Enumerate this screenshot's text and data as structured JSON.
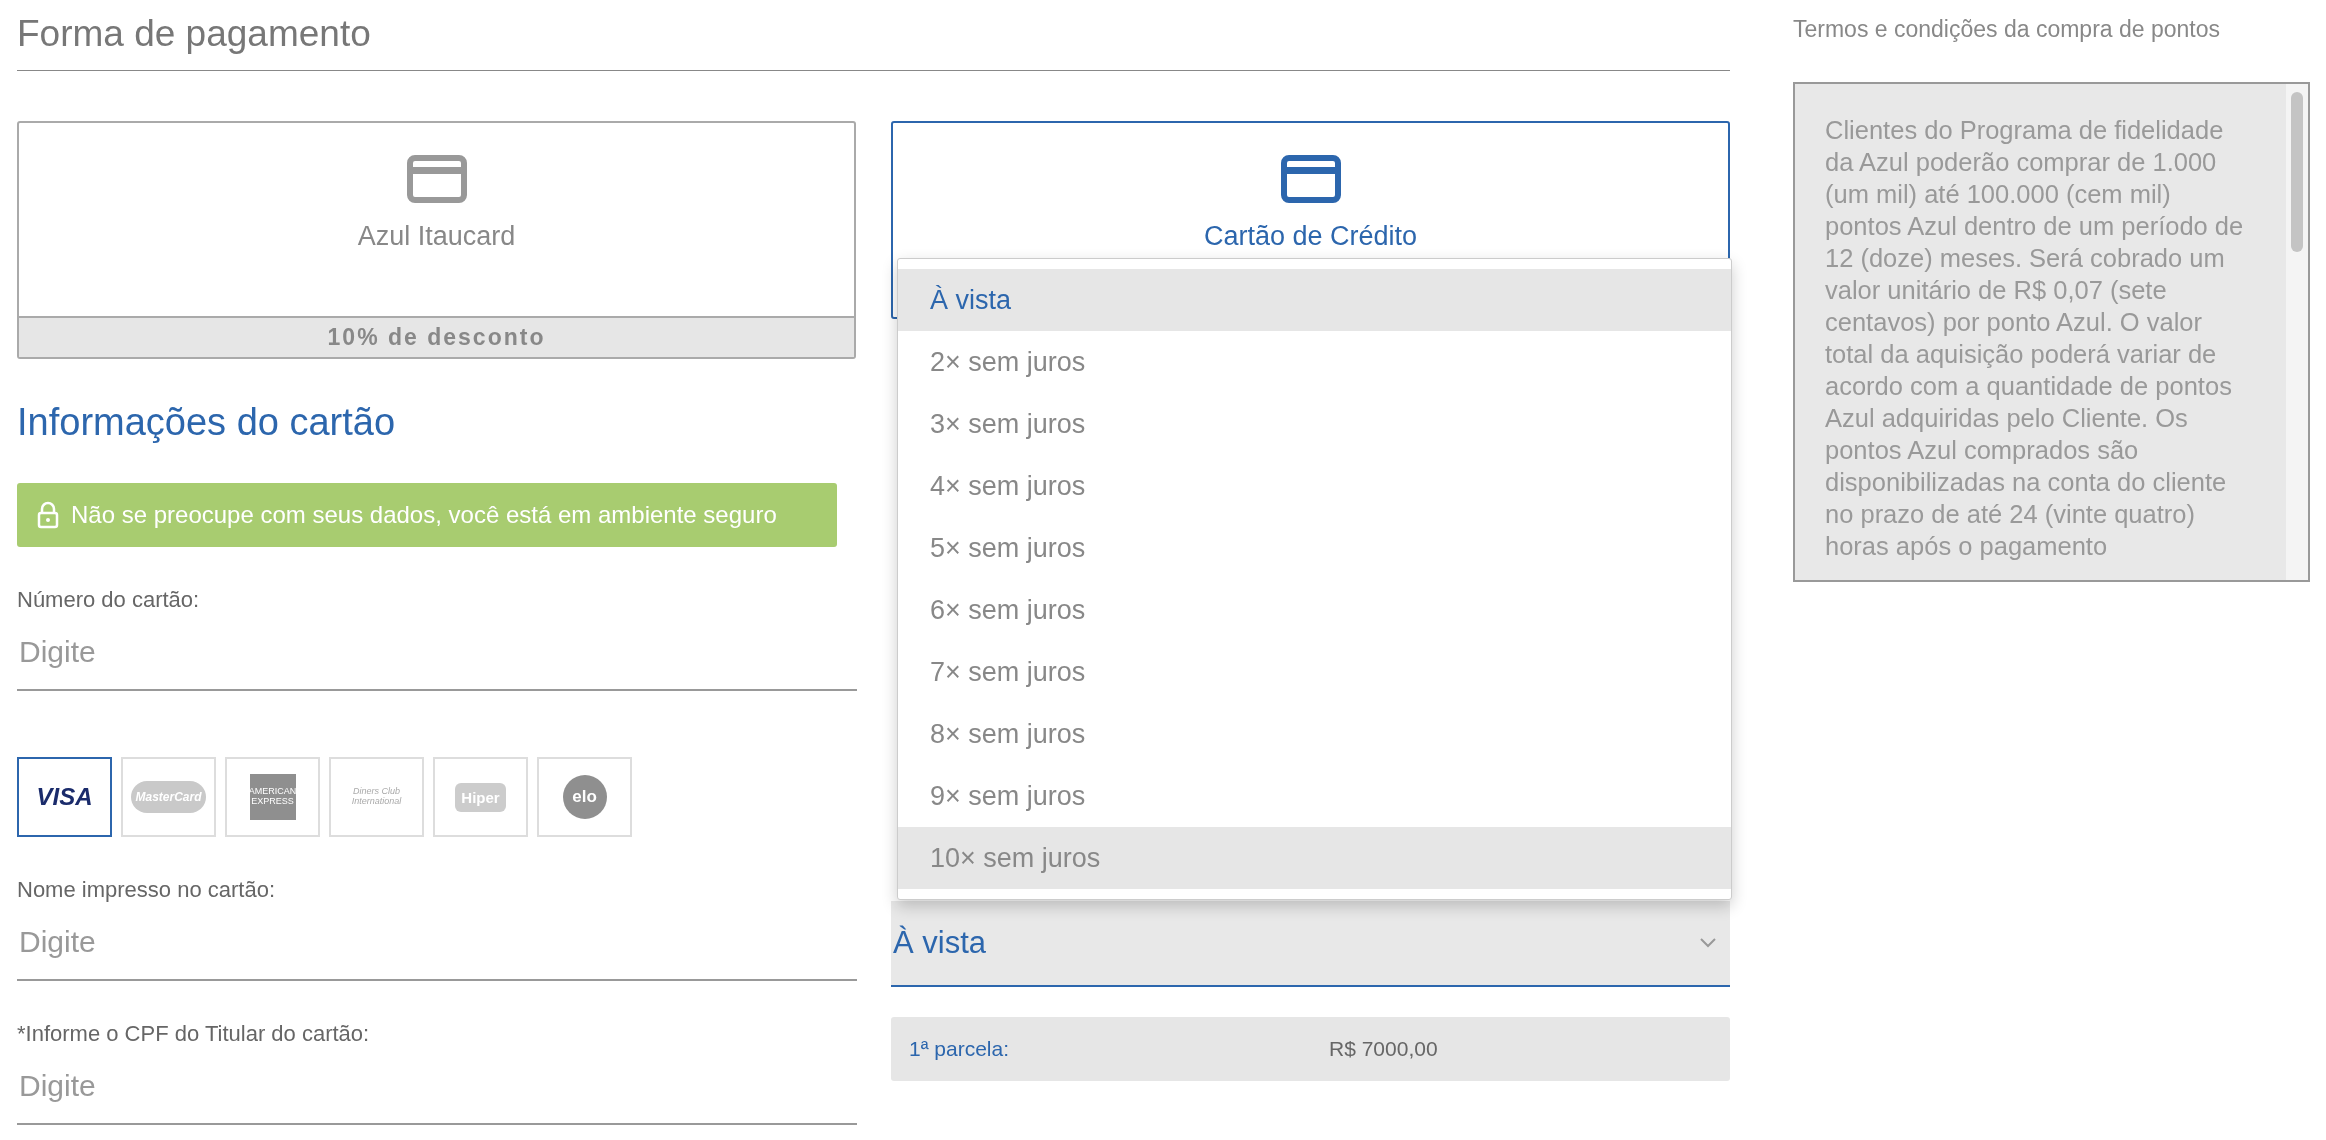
{
  "title": "Forma de pagamento",
  "methods": [
    {
      "label": "Azul Itaucard",
      "selected": false,
      "discount": "10% de desconto"
    },
    {
      "label": "Cartão de Crédito",
      "selected": true
    }
  ],
  "card_info": {
    "heading": "Informações do cartão",
    "secure_notice": "Não se preocupe com seus dados, você está em ambiente seguro",
    "fields": [
      {
        "label": "Número do cartão:",
        "placeholder": "Digite"
      },
      {
        "label": "Nome impresso no cartão:",
        "placeholder": "Digite"
      },
      {
        "label": "*Informe o CPF do Titular do cartão:",
        "placeholder": "Digite"
      }
    ],
    "brands": [
      {
        "kind": "visa",
        "label": "VISA",
        "selected": true
      },
      {
        "kind": "mastercard",
        "label": "MasterCard",
        "selected": false
      },
      {
        "kind": "amex",
        "label": "AMERICAN EXPRESS",
        "selected": false
      },
      {
        "kind": "diners",
        "label": "Diners Club International",
        "selected": false
      },
      {
        "kind": "hiper",
        "label": "Hiper",
        "selected": false
      },
      {
        "kind": "elo",
        "label": "elo",
        "selected": false
      }
    ]
  },
  "installments": {
    "value": "À vista",
    "options": [
      {
        "label": "À vista",
        "selected": true,
        "highlighted": false
      },
      {
        "label": "2× sem juros",
        "selected": false,
        "highlighted": false
      },
      {
        "label": "3× sem juros",
        "selected": false,
        "highlighted": false
      },
      {
        "label": "4× sem juros",
        "selected": false,
        "highlighted": false
      },
      {
        "label": "5× sem juros",
        "selected": false,
        "highlighted": false
      },
      {
        "label": "6× sem juros",
        "selected": false,
        "highlighted": false
      },
      {
        "label": "7× sem juros",
        "selected": false,
        "highlighted": false
      },
      {
        "label": "8× sem juros",
        "selected": false,
        "highlighted": false
      },
      {
        "label": "9× sem juros",
        "selected": false,
        "highlighted": false
      },
      {
        "label": "10× sem juros",
        "selected": false,
        "highlighted": true
      }
    ],
    "first_label": "1ª parcela:",
    "first_value": "R$ 7000,00"
  },
  "terms": {
    "title": "Termos e condições da compra de pontos",
    "text": "Clientes do Programa de fidelidade da Azul poderão comprar de 1.000 (um mil) até 100.000 (cem mil) pontos Azul dentro de um período de 12 (doze) meses. Será cobrado um valor unitário de R$ 0,07 (sete centavos) por ponto Azul. O valor total da aquisição poderá variar de acordo com a quantidade de pontos Azul adquiridas pelo Cliente. Os pontos Azul comprados são disponibilizadas na conta do cliente no prazo de até 24 (vinte quatro) horas após o pagamento"
  }
}
